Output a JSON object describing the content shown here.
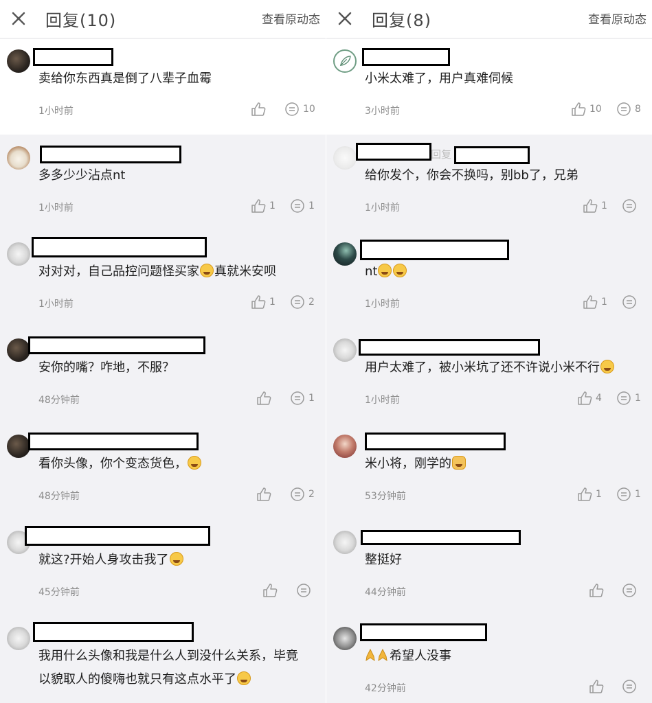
{
  "left_panel": {
    "title": "回复(10)",
    "original_post_link": "查看原动态",
    "comments": [
      {
        "content": "卖给你东西真是倒了八辈子血霉",
        "time": "1小时前",
        "likes": "",
        "replies": "10"
      },
      {
        "content": "多多少少沾点nt",
        "time": "1小时前",
        "likes": "1",
        "replies": "1"
      },
      {
        "content_before": "对对对，自己品控问题怪买家",
        "content_after": "真就米安呗",
        "time": "1小时前",
        "likes": "1",
        "replies": "2"
      },
      {
        "content": "安你的嘴？咋地，不服？",
        "time": "48分钟前",
        "likes": "",
        "replies": "1"
      },
      {
        "content": "看你头像，你个变态货色，",
        "time": "48分钟前",
        "likes": "",
        "replies": "2"
      },
      {
        "content": "就这?开始人身攻击我了",
        "time": "45分钟前",
        "likes": "",
        "replies": ""
      },
      {
        "content_line1": "我用什么头像和我是什么人到没什么关系，毕竟",
        "content_line2": "以貌取人的傻嗨也就只有这点水平了",
        "time": "",
        "likes": "",
        "replies": ""
      }
    ]
  },
  "right_panel": {
    "title": "回复(8)",
    "original_post_link": "查看原动态",
    "comments": [
      {
        "content": "小米太难了，用户真难伺候",
        "time": "3小时前",
        "likes": "10",
        "replies": "8"
      },
      {
        "reply_label": "回复",
        "content": "给你发个，你会不换吗，别bb了，兄弟",
        "time": "1小时前",
        "likes": "1",
        "replies": ""
      },
      {
        "content": "nt",
        "time": "1小时前",
        "likes": "1",
        "replies": ""
      },
      {
        "content": "用户太难了，被小米坑了还不许说小米不行",
        "time": "1小时前",
        "likes": "4",
        "replies": "1"
      },
      {
        "content": "米小将，刚学的",
        "time": "53分钟前",
        "likes": "1",
        "replies": "1"
      },
      {
        "content": "整挺好",
        "time": "44分钟前",
        "likes": "",
        "replies": ""
      },
      {
        "content": "希望人没事",
        "time": "42分钟前",
        "likes": "",
        "replies": ""
      }
    ]
  },
  "icons": {
    "close": "close-icon",
    "like": "thumbs-up-icon",
    "reply": "comment-bubble-icon"
  }
}
